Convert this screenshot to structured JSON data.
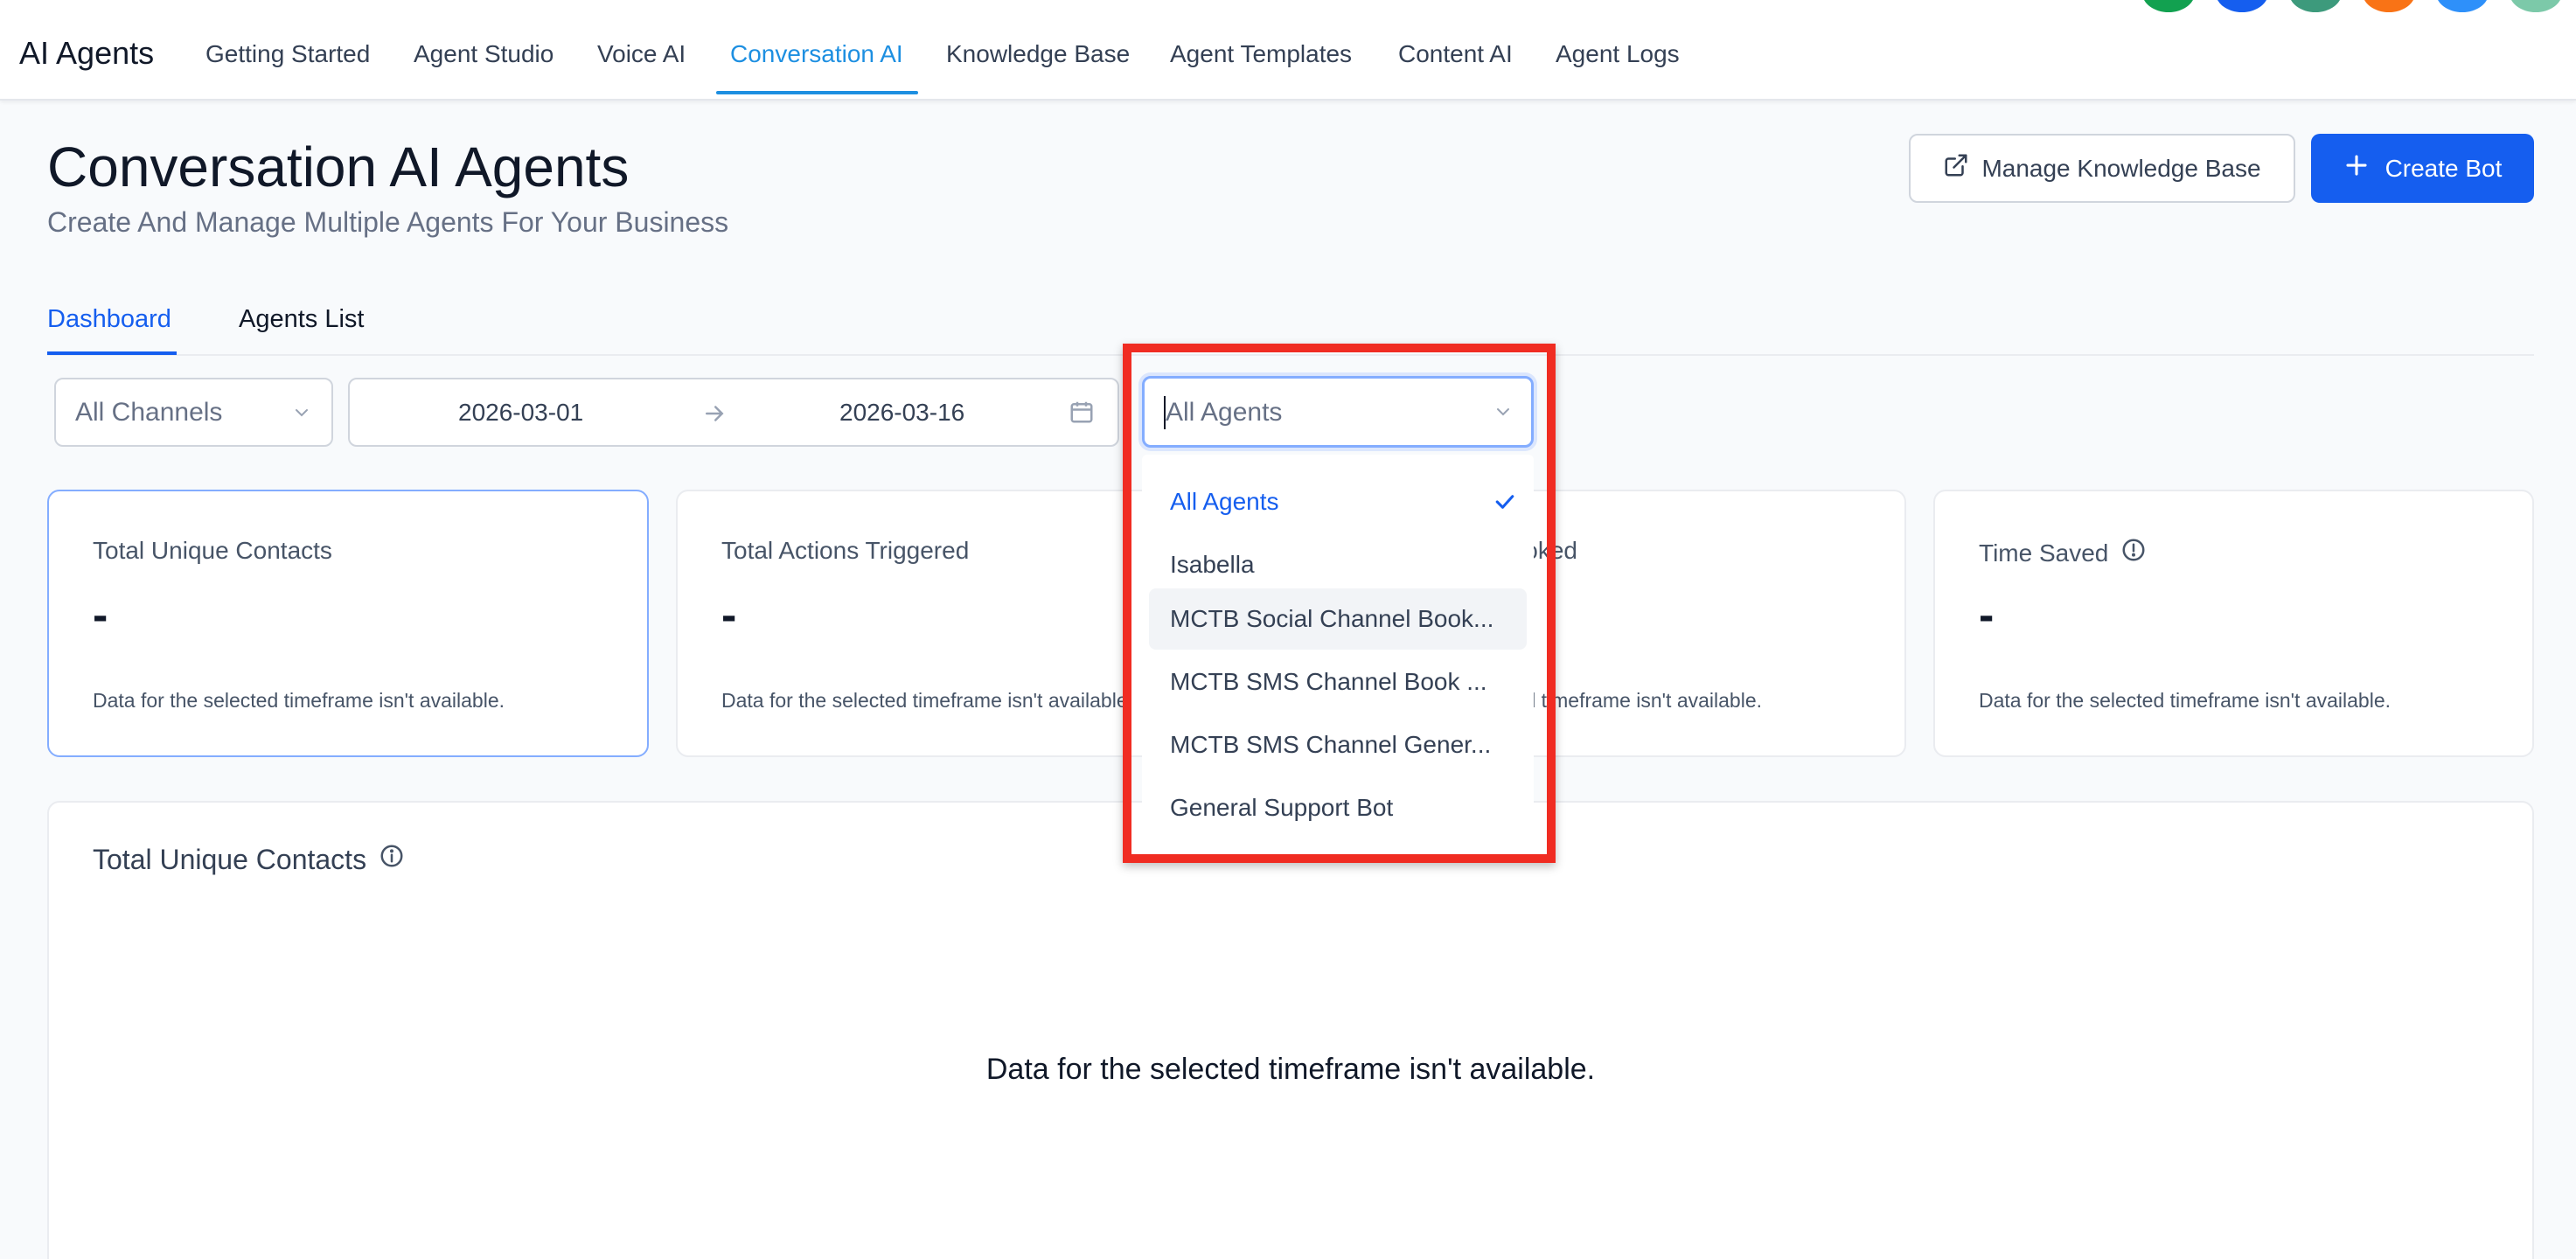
{
  "nav": {
    "brand": "AI Agents",
    "tabs": [
      {
        "label": "Getting Started"
      },
      {
        "label": "Agent Studio"
      },
      {
        "label": "Voice AI"
      },
      {
        "label": "Conversation AI"
      },
      {
        "label": "Knowledge Base"
      },
      {
        "label": "Agent Templates"
      },
      {
        "label": "Content AI"
      },
      {
        "label": "Agent Logs"
      }
    ],
    "active_tab": "Conversation AI",
    "avatar_colors": [
      "#12a150",
      "#155eef",
      "#3d9a7c",
      "#f97316",
      "#2e90fa",
      "#7cc9a9"
    ]
  },
  "header": {
    "title": "Conversation AI Agents",
    "subtitle": "Create And Manage Multiple Agents For Your Business",
    "manage_kb_label": "Manage Knowledge Base",
    "create_bot_label": "Create Bot"
  },
  "subtabs": {
    "dashboard": "Dashboard",
    "agents_list": "Agents List"
  },
  "filters": {
    "channel": "All Channels",
    "date_start": "2026-03-01",
    "date_end": "2026-03-16",
    "agent": "All Agents"
  },
  "agent_menu": {
    "items": [
      {
        "label": "All Agents",
        "selected": true
      },
      {
        "label": "Isabella"
      },
      {
        "label": "MCTB Social Channel Book..."
      },
      {
        "label": "MCTB SMS Channel Book ..."
      },
      {
        "label": "MCTB SMS Channel Gener..."
      },
      {
        "label": "General Support Bot"
      }
    ]
  },
  "cards": [
    {
      "label": "Total Unique Contacts",
      "value": "-",
      "note": "Data for the selected timeframe isn't available."
    },
    {
      "label": "Total Actions Triggered",
      "value": "-",
      "note": "Data for the selected timeframe isn't available."
    },
    {
      "label": "Appointment Booked",
      "value": "-",
      "note": "Data for the selected timeframe isn't available."
    },
    {
      "label": "Time Saved",
      "value": "-",
      "note": "Data for the selected timeframe isn't available."
    }
  ],
  "panel": {
    "title": "Total Unique Contacts",
    "empty_message": "Data for the selected timeframe isn't available."
  },
  "colors": {
    "accent": "#155eef",
    "nav_active": "#1d8fe1",
    "highlight": "#f02c22"
  }
}
